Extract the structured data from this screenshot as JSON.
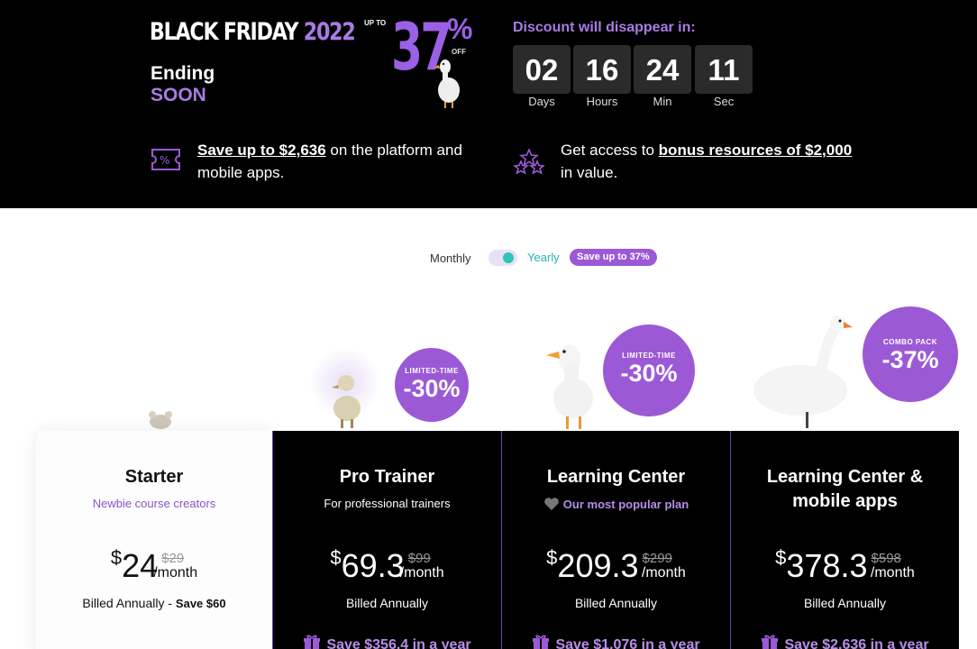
{
  "banner": {
    "title_main": "BLACK FRIDAY",
    "title_year": "2022",
    "ending_line1": "Ending",
    "ending_line2": "SOON",
    "up_to": "UP TO",
    "big_percent": "37",
    "percent_sign": "%",
    "off": "OFF",
    "countdown_label": "Discount will disappear in:",
    "countdown": [
      {
        "value": "02",
        "label": "Days"
      },
      {
        "value": "16",
        "label": "Hours"
      },
      {
        "value": "24",
        "label": "Min"
      },
      {
        "value": "11",
        "label": "Sec"
      }
    ],
    "perk1": {
      "link": "Save up to $2,636",
      "text": " on the platform and",
      "text2": "mobile apps."
    },
    "perk2": {
      "text": "Get access to ",
      "link": "bonus resources of $2,000",
      "text2": "in value."
    }
  },
  "billing_toggle": {
    "monthly": "Monthly",
    "yearly": "Yearly",
    "badge": "Save up to 37%",
    "selected": "Yearly"
  },
  "bubbles": [
    {
      "small": "LIMITED-TIME",
      "big": "-30%"
    },
    {
      "small": "LIMITED-TIME",
      "big": "-30%"
    },
    {
      "small": "COMBO PACK",
      "big": "-37%"
    }
  ],
  "plans": [
    {
      "name": "Starter",
      "subtitle": "Newbie course creators",
      "currency": "$",
      "price": "24",
      "old_price": "$29",
      "period": "/month",
      "billed": "Billed Annually - ",
      "billed_save": "Save $60"
    },
    {
      "name": "Pro Trainer",
      "subtitle": "For professional trainers",
      "currency": "$",
      "price": "69.3",
      "old_price": "$99",
      "period": "/month",
      "billed": "Billed Annually",
      "save_year": "Save $356.4 in a year"
    },
    {
      "name": "Learning Center",
      "subtitle": "Our most popular plan",
      "currency": "$",
      "price": "209.3",
      "old_price": "$299",
      "period": "/month",
      "billed": "Billed Annually",
      "save_year": "Save $1,076 in a year"
    },
    {
      "name_line1": "Learning Center &",
      "name_line2": "mobile apps",
      "currency": "$",
      "price": "378.3",
      "old_price": "$598",
      "period": "/month",
      "billed": "Billed Annually",
      "save_year": "Save $2,636 in a year"
    }
  ],
  "colors": {
    "accent": "#9b59d6",
    "accent_light": "#a97be6",
    "teal": "#2ec4b6"
  }
}
